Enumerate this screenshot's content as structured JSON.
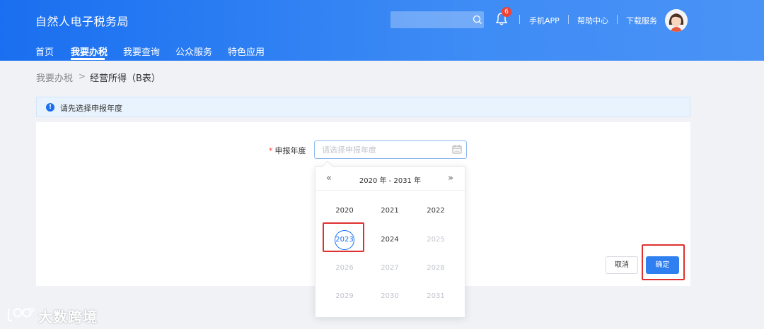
{
  "header": {
    "brand": "自然人电子税务局",
    "search_placeholder": "",
    "notification_count": "6",
    "links": [
      "手机APP",
      "帮助中心",
      "下载服务"
    ]
  },
  "nav": {
    "items": [
      "首页",
      "我要办税",
      "我要查询",
      "公众服务",
      "特色应用"
    ],
    "active": "我要办税"
  },
  "breadcrumb": {
    "parent": "我要办税",
    "separator": ">",
    "current": "经营所得（B表）"
  },
  "alert": {
    "icon": "info-icon",
    "text": "请先选择申报年度"
  },
  "form": {
    "label": "申报年度",
    "required_mark": "*",
    "placeholder": "请选择申报年度",
    "value": ""
  },
  "picker": {
    "prev_label": "«",
    "next_label": "»",
    "range_label": "2020 年 - 2031 年",
    "years": [
      {
        "label": "2020",
        "state": "normal"
      },
      {
        "label": "2021",
        "state": "normal"
      },
      {
        "label": "2022",
        "state": "normal"
      },
      {
        "label": "2023",
        "state": "selected"
      },
      {
        "label": "2024",
        "state": "normal"
      },
      {
        "label": "2025",
        "state": "disabled"
      },
      {
        "label": "2026",
        "state": "disabled"
      },
      {
        "label": "2027",
        "state": "disabled"
      },
      {
        "label": "2028",
        "state": "disabled"
      },
      {
        "label": "2029",
        "state": "disabled"
      },
      {
        "label": "2030",
        "state": "disabled"
      },
      {
        "label": "2031",
        "state": "disabled"
      }
    ]
  },
  "actions": {
    "cancel": "取消",
    "confirm": "确定"
  },
  "watermark": {
    "text": "大数跨境"
  },
  "colors": {
    "primary": "#1a6ff0",
    "highlight": "#e03030",
    "badge": "#f04134"
  }
}
